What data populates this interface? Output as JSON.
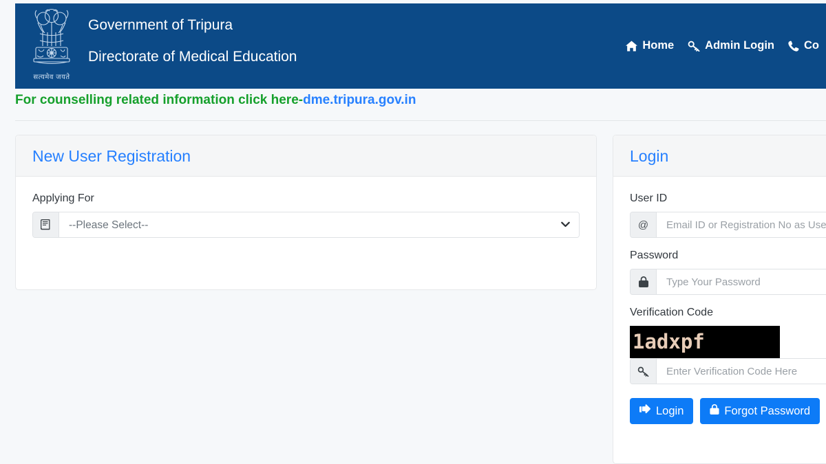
{
  "header": {
    "org_line1": "Government of Tripura",
    "org_line2": "Directorate of Medical Education",
    "emblem_motto": "सत्यमेव जयते",
    "emblem_icon": "ashoka-lion-capital-emblem",
    "nav": [
      {
        "label": "Home",
        "icon": "home-icon"
      },
      {
        "label": "Admin Login",
        "icon": "key-icon"
      },
      {
        "label": "Co",
        "icon": "phone-icon"
      }
    ]
  },
  "notice": {
    "text": "For counselling related information click here-",
    "link_text": "dme.tripura.gov.in",
    "text_color": "#16a02c",
    "link_color": "#2680ff"
  },
  "registration": {
    "title": "New User Registration",
    "applying_for_label": "Applying For",
    "applying_for_icon": "book-icon",
    "applying_for_value": "--Please Select--",
    "applying_for_options": [
      "--Please Select--"
    ]
  },
  "login": {
    "title": "Login",
    "user_id_label": "User ID",
    "user_id_icon": "at-icon",
    "user_id_value": "",
    "user_id_placeholder": "Email ID or Registration No as User ID",
    "password_label": "Password",
    "password_icon": "lock-icon",
    "password_value": "",
    "password_placeholder": "Type Your Password",
    "verification_label": "Verification Code",
    "captcha_text": "1adxpf",
    "captcha_bg": "#000000",
    "captcha_fg": "#e8cdb8",
    "captcha_input_icon": "key-icon",
    "captcha_value": "",
    "captcha_placeholder": "Enter Verification Code Here",
    "login_button": "Login",
    "login_button_icon": "sign-in-icon",
    "forgot_button": "Forgot Password",
    "forgot_button_icon": "lock-icon",
    "button_color": "#0d7bf7"
  },
  "theme": {
    "header_bg": "#0c4a87",
    "page_bg": "#f6f8fa",
    "card_title_color": "#2680ff",
    "card_head_bg": "#f5f6f7"
  }
}
